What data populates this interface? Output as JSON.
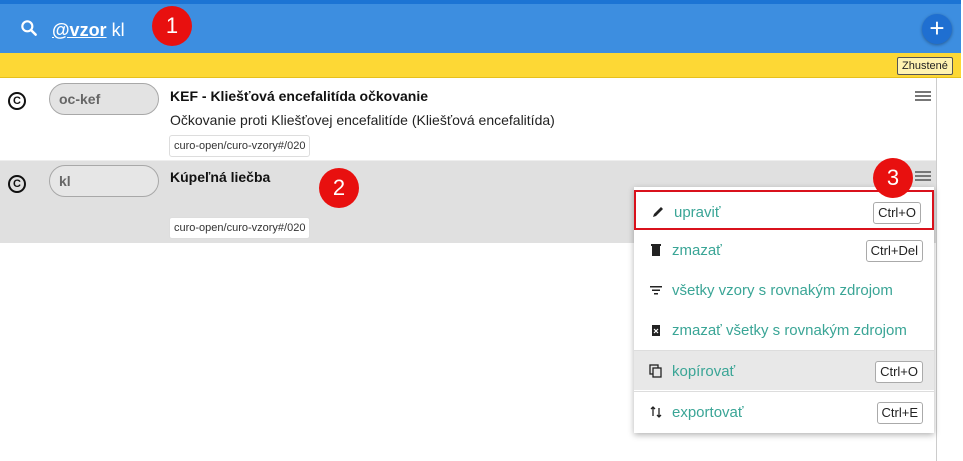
{
  "search": {
    "prefix": "@vzor",
    "query": " kl"
  },
  "header": {
    "add_label": "+"
  },
  "toolbar": {
    "compact_label": "Zhustené"
  },
  "rows": [
    {
      "icon_letter": "C",
      "code": "oc-kef",
      "title": "KEF - Kliešťová encefalitída očkovanie",
      "description": "Očkovanie proti Kliešťovej encefalitíde (Kliešťová encefalitída)",
      "tag": "curo-open/curo-vzory#/020"
    },
    {
      "icon_letter": "C",
      "code": "kl",
      "title": "Kúpeľná liečba",
      "description": "",
      "tag": "curo-open/curo-vzory#/020"
    }
  ],
  "badges": [
    "1",
    "2",
    "3"
  ],
  "menu": {
    "items": [
      {
        "label": "upraviť",
        "shortcut": "Ctrl+O",
        "icon": "pencil-icon"
      },
      {
        "label": "zmazať",
        "shortcut": "Ctrl+Del",
        "icon": "trash-icon"
      },
      {
        "label": "všetky vzory s rovnakým zdrojom",
        "shortcut": "",
        "icon": "filter-icon"
      },
      {
        "label": "zmazať všetky s rovnakým zdrojom",
        "shortcut": "",
        "icon": "delete-sweep-icon"
      },
      {
        "label": "kopírovať",
        "shortcut": "Ctrl+O",
        "icon": "copy-icon"
      },
      {
        "label": "exportovať",
        "shortcut": "Ctrl+E",
        "icon": "swap-vertical-icon"
      }
    ]
  },
  "colors": {
    "header_blue": "#3d8ee0",
    "warning_yellow": "#fdd835",
    "menu_text": "#3aa596",
    "badge_red": "#e8100f"
  }
}
